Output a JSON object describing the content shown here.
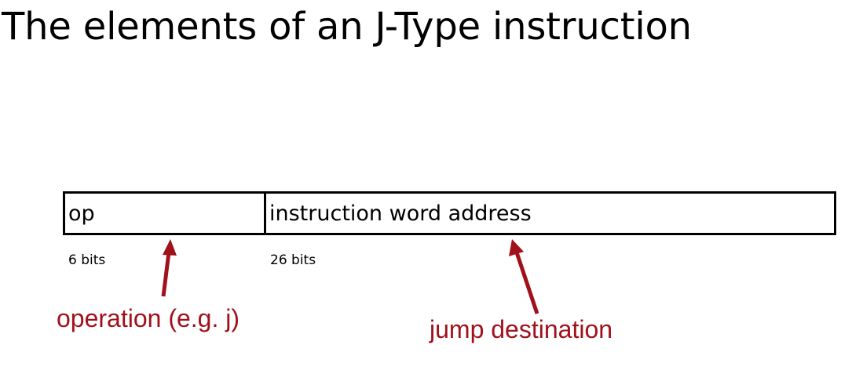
{
  "title": "The elements of an J-Type instruction",
  "fields": [
    {
      "label": "op",
      "bits": "6 bits"
    },
    {
      "label": "instruction word address",
      "bits": "26 bits"
    }
  ],
  "annotations": {
    "op": "operation (e.g. j)",
    "address": "jump destination"
  },
  "colors": {
    "annotation": "#a0111b",
    "border": "#000000"
  }
}
